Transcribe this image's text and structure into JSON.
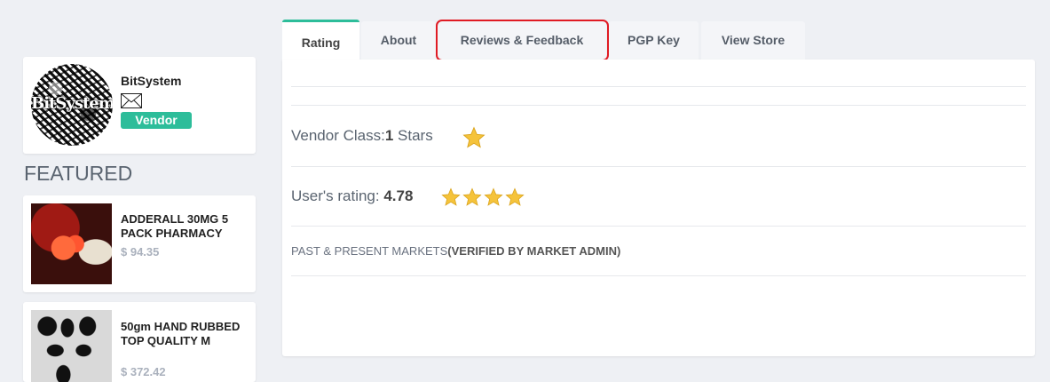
{
  "vendor": {
    "avatar_text": "BitSystem",
    "name": "BitSystem",
    "badge": "Vendor"
  },
  "featured": {
    "heading": "FEATURED",
    "products": [
      {
        "name": "ADDERALL 30MG 5 PACK PHARMACY",
        "price": "$ 94.35"
      },
      {
        "name": "50gm HAND RUBBED TOP QUALITY M",
        "price": "$ 372.42"
      }
    ]
  },
  "tabs": [
    {
      "label": "Rating",
      "active": true
    },
    {
      "label": "About",
      "active": false
    },
    {
      "label": "Reviews & Feedback",
      "active": false
    },
    {
      "label": "PGP Key",
      "active": false
    },
    {
      "label": "View Store",
      "active": false
    }
  ],
  "rating": {
    "vendor_class_label": "Vendor Class:",
    "vendor_class_value": "1",
    "vendor_class_suffix": " Stars",
    "vendor_class_stars": 1,
    "user_rating_label": "User's rating: ",
    "user_rating_value": "4.78",
    "user_rating_stars": 4,
    "markets_label": "PAST & PRESENT MARKETS",
    "markets_verified": "(VERIFIED BY MARKET ADMIN)"
  },
  "colors": {
    "accent": "#2dbd9a",
    "highlight": "#e01b24",
    "star": "#f5c33b"
  }
}
